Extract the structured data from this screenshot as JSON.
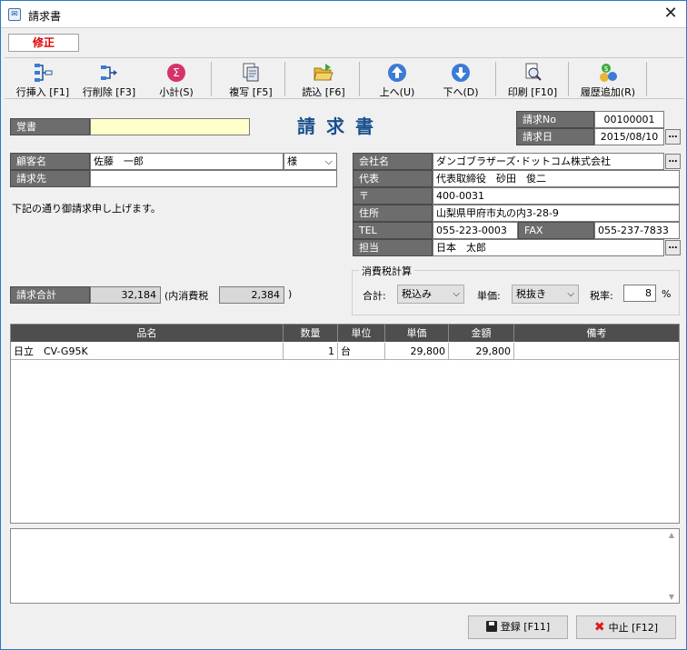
{
  "window": {
    "title": "請求書",
    "mode": "修正"
  },
  "toolbar": [
    {
      "name": "row-insert-button",
      "label": "行挿入 [F1]"
    },
    {
      "name": "row-delete-button",
      "label": "行削除 [F3]"
    },
    {
      "name": "subtotal-button",
      "label": "小計(S)"
    },
    {
      "name": "copy-button",
      "label": "複写 [F5]"
    },
    {
      "name": "load-button",
      "label": "読込 [F6]"
    },
    {
      "name": "move-up-button",
      "label": "上へ(U)"
    },
    {
      "name": "move-down-button",
      "label": "下へ(D)"
    },
    {
      "name": "print-button",
      "label": "印刷 [F10]"
    },
    {
      "name": "add-history-button",
      "label": "履歴追加(R)"
    }
  ],
  "memo": {
    "label": "覚書",
    "value": ""
  },
  "doc_title": "請求書",
  "invoice": {
    "no_label": "請求No",
    "no": "00100001",
    "date_label": "請求日",
    "date": "2015/08/10"
  },
  "customer": {
    "name_label": "顧客名",
    "name": "佐藤　一郎",
    "honorific": "様",
    "bill_to_label": "請求先",
    "bill_to": ""
  },
  "greeting": "下記の通り御請求申し上げます。",
  "company": {
    "name_label": "会社名",
    "name": "ダンゴブラザーズ･ドットコム株式会社",
    "rep_label": "代表",
    "rep": "代表取締役　砂田　俊二",
    "zip_label": "〒",
    "zip": "400-0031",
    "address_label": "住所",
    "address": "山梨県甲府市丸の内3-28-9",
    "tel_label": "TEL",
    "tel": "055-223-0003",
    "fax_label": "FAX",
    "fax": "055-237-7833",
    "staff_label": "担当",
    "staff": "日本　太郎"
  },
  "totals": {
    "label": "請求合計",
    "total": "32,184",
    "tax_label": "(内消費税",
    "tax": "2,384",
    "close": ")"
  },
  "tax_calc": {
    "legend": "消費税計算",
    "total_label": "合計:",
    "total_mode": "税込み",
    "unit_label": "単価:",
    "unit_mode": "税抜き",
    "rate_label": "税率:",
    "rate": "8",
    "rate_unit": "%"
  },
  "grid": {
    "headers": [
      "品名",
      "数量",
      "単位",
      "単価",
      "金額",
      "備考"
    ],
    "rows": [
      [
        "日立　CV-G95K",
        "1",
        "台",
        "29,800",
        "29,800",
        ""
      ]
    ]
  },
  "buttons": {
    "register": "登録 [F11]",
    "cancel": "中止 [F12]"
  },
  "colors": {
    "title_blue": "#1a4f8c",
    "mode_red": "#e00000",
    "memo_yellow": "#ffffcc"
  }
}
